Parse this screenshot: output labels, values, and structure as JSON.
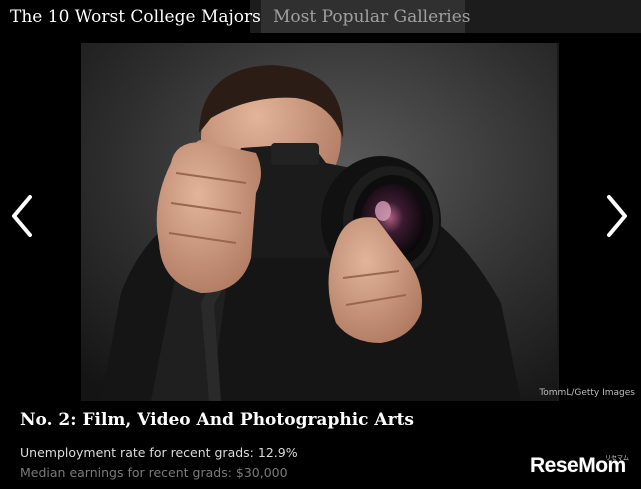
{
  "tabs": {
    "active": "The 10 Worst College Majors",
    "inactive": "Most Popular Galleries"
  },
  "slide": {
    "photo_credit": "TommL/Getty Images",
    "title": "No. 2: Film, Video And Photographic Arts",
    "stat_unemployment": "Unemployment rate for recent grads: 12.9%",
    "stat_earnings": "Median earnings for recent grads: $30,000"
  },
  "navigation": {
    "prev_icon": "chevron-left-icon",
    "next_icon": "chevron-right-icon"
  },
  "watermark": {
    "text": "ReseMom",
    "tag": "リセマム"
  },
  "colors": {
    "background": "#000000",
    "tab_active_bg": "#000000",
    "tab_inactive_bg": "#303030",
    "tab_inactive_text": "#a0a0a0",
    "title_text": "#ffffff",
    "stat_primary": "#dcdcdc",
    "stat_secondary": "#7a7a7a"
  }
}
